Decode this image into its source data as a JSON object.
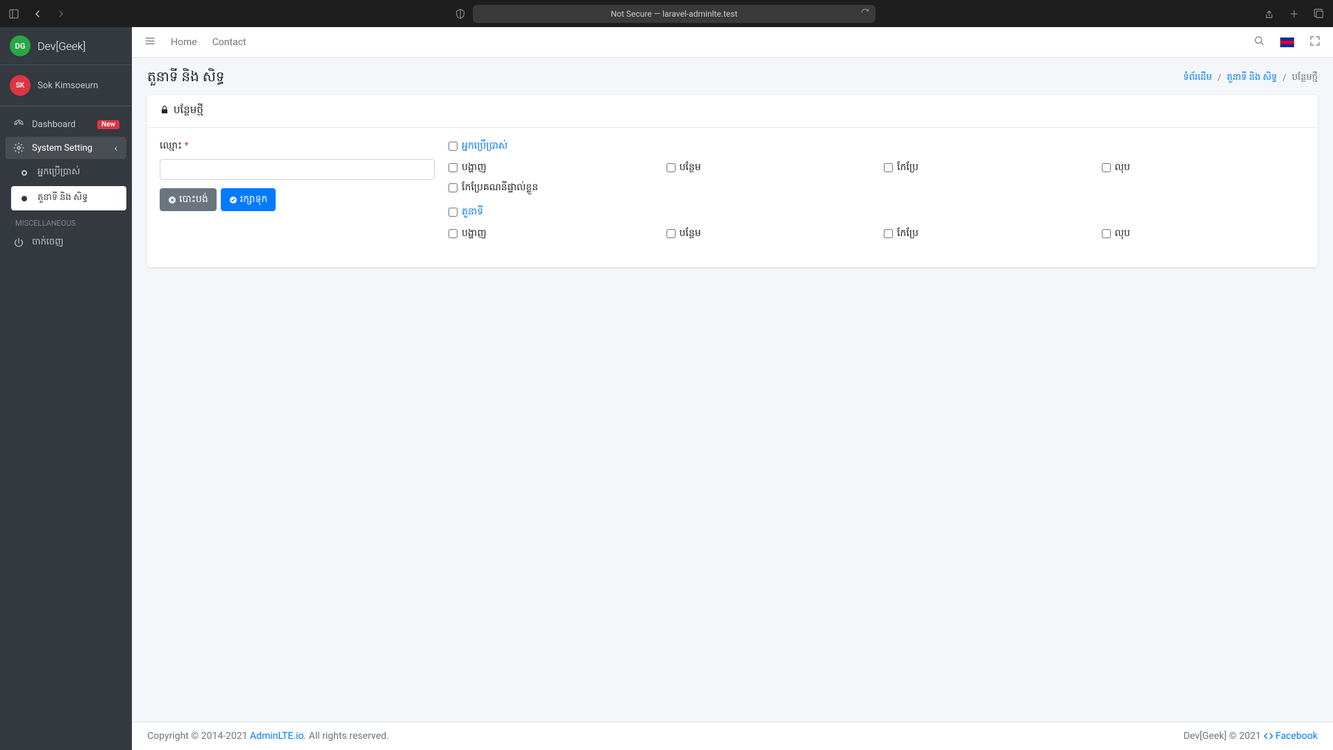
{
  "browser": {
    "url_label": "Not Secure — laravel-adminlte.test"
  },
  "brand": {
    "logo_initials": "DG",
    "name": "Dev[Geek]"
  },
  "user": {
    "initials": "SK",
    "name": "Sok Kimsoeurn"
  },
  "sidebar": {
    "dashboard": {
      "label": "Dashboard",
      "badge": "New"
    },
    "system_setting": {
      "label": "System Setting"
    },
    "users": {
      "label": "អ្នកប្រើប្រាស់"
    },
    "roles": {
      "label": "តួនាទី និង សិទ្ធ"
    },
    "misc_header": "MISCELLANEOUS",
    "logout": {
      "label": "ចាក់ចេញ"
    }
  },
  "topbar": {
    "home": "Home",
    "contact": "Contact"
  },
  "page": {
    "title": "តួនាទី និង សិទ្ធ",
    "breadcrumb": {
      "home": "ទំព័រដើម",
      "parent": "តួនាទី និង សិទ្ធ",
      "current": "បន្ថែមថ្មី"
    }
  },
  "card": {
    "title": "បន្ថែមថ្មី",
    "name_label": "ឈ្មោះ",
    "cancel_btn": "បោះបង់",
    "save_btn": "រក្សាទុក"
  },
  "permissions": {
    "group1": {
      "title": "អ្នកប្រើប្រាស់",
      "items": {
        "view": "បង្ហាញ",
        "create": "បន្ថែម",
        "edit": "កែប្រែ",
        "delete": "លុប",
        "edit_own": "កែប្រែគណនីផ្ទាល់ខ្លួន"
      }
    },
    "group2": {
      "title": "តួនាទី",
      "items": {
        "view": "បង្ហាញ",
        "create": "បន្ថែម",
        "edit": "កែប្រែ",
        "delete": "លុប"
      }
    }
  },
  "footer": {
    "copyright_pre": "Copyright © 2014-2021 ",
    "link": "AdminLTE.io",
    "copyright_post": ". All rights reserved.",
    "right_pre": "Dev[Geek] © 2021 ",
    "facebook": "Facebook"
  }
}
